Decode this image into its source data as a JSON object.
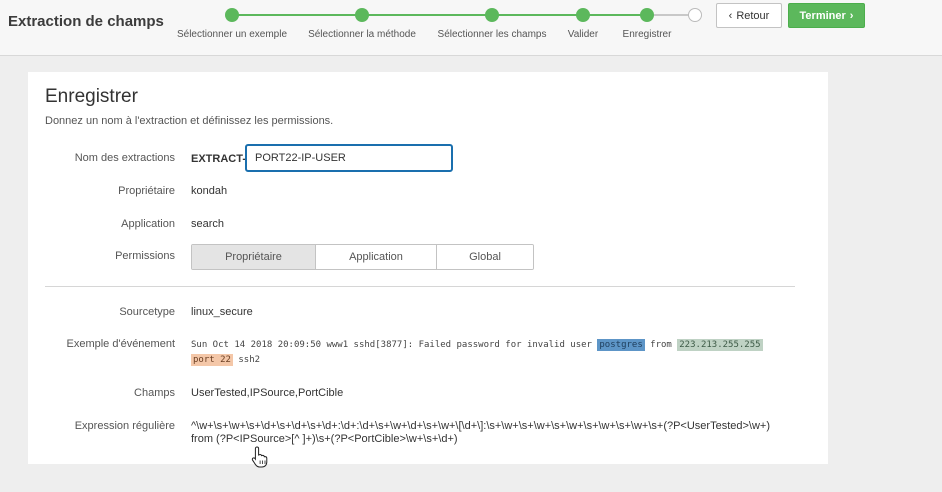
{
  "header": {
    "title": "Extraction de champs",
    "back_label": "Retour",
    "finish_label": "Terminer",
    "back_icon": "chevron-left-icon",
    "finish_icon": "chevron-right-icon"
  },
  "wizard": {
    "steps": [
      {
        "label": "Sélectionner un exemple",
        "status": "done"
      },
      {
        "label": "Sélectionner la méthode",
        "status": "done"
      },
      {
        "label": "Sélectionner les champs",
        "status": "done"
      },
      {
        "label": "Valider",
        "status": "done"
      },
      {
        "label": "Enregistrer",
        "status": "current"
      },
      {
        "label": "",
        "status": "pending"
      }
    ]
  },
  "form": {
    "title": "Enregistrer",
    "subtitle": "Donnez un nom à l'extraction et définissez les permissions.",
    "name_label": "Nom des extractions",
    "name_prefix": "EXTRACT-",
    "name_value": "PORT22-IP-USER",
    "owner_label": "Propriétaire",
    "owner_value": "kondah",
    "app_label": "Application",
    "app_value": "search",
    "permissions_label": "Permissions",
    "permissions_options": [
      "Propriétaire",
      "Application",
      "Global"
    ],
    "permissions_selected": "Propriétaire",
    "sourcetype_label": "Sourcetype",
    "sourcetype_value": "linux_secure",
    "event_label": "Exemple d'événement",
    "event": {
      "pre": "Sun Oct 14 2018 20:09:50 www1 sshd[3877]: Failed password for invalid user ",
      "user": "postgres",
      "mid": " from ",
      "ip": "223.213.255.255",
      "port": "port 22",
      "post": " ssh2"
    },
    "fields_label": "Champs",
    "fields_value": "UserTested,IPSource,PortCible",
    "regex_label": "Expression régulière",
    "regex_line1": "^\\w+\\s+\\w+\\s+\\d+\\s+\\d+\\s+\\d+:\\d+:\\d+\\s+\\w+\\d+\\s+\\w+\\[\\d+\\]:\\s+\\w+\\s+\\w+\\s+\\w+\\s+\\w+\\s+\\w+\\s+(?P<UserTested>\\w+)",
    "regex_line2": "from (?P<IPSource>[^ ]+)\\s+(?P<PortCible>\\w+\\s+\\d+)"
  },
  "colors": {
    "accent_green": "#5cb85c",
    "focus_blue": "#1a6fae",
    "user_highlight": "#5d95c7",
    "ip_highlight": "#bfd2c4",
    "port_highlight": "#f4c7a8"
  }
}
